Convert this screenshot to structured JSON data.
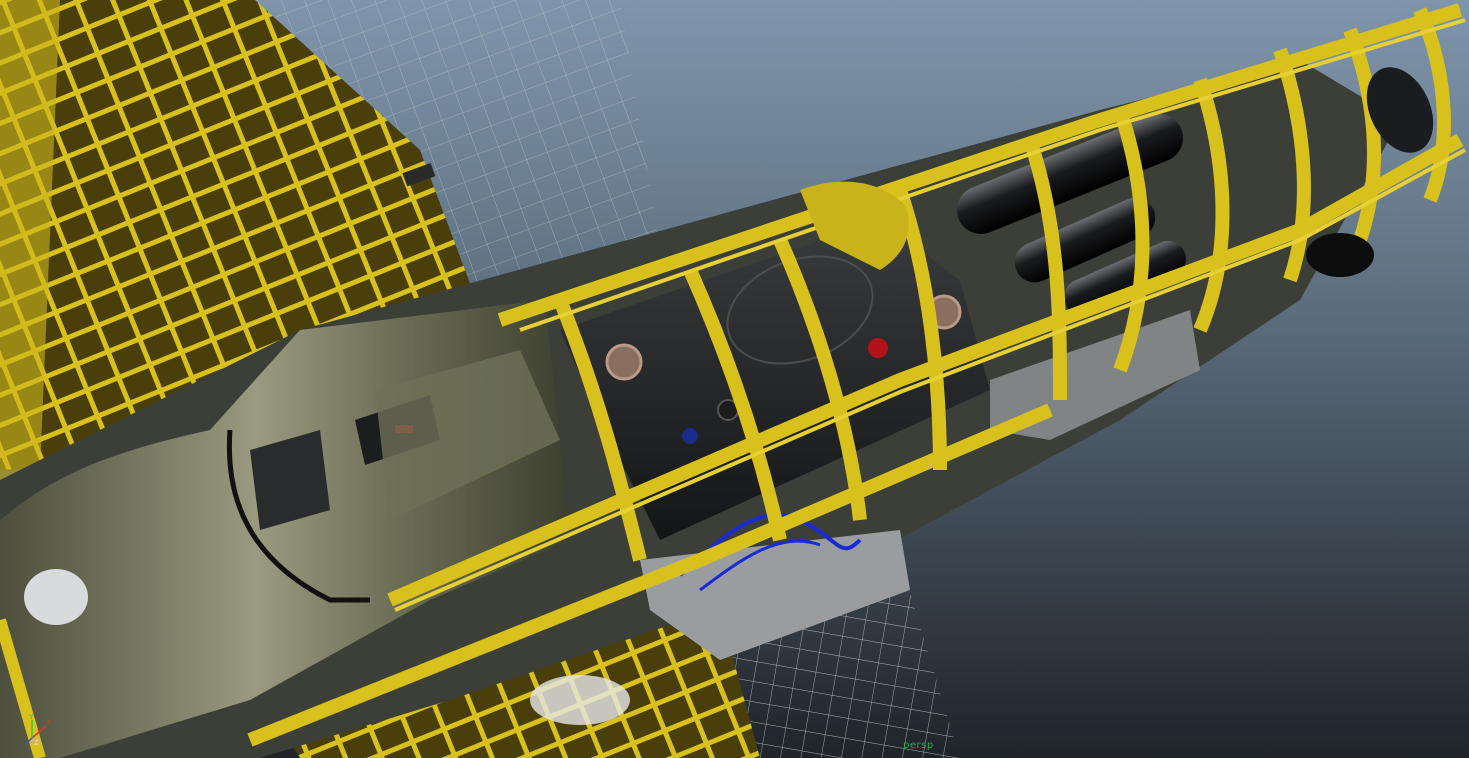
{
  "viewport": {
    "camera_label": "persp",
    "background_top": "#7f95ab",
    "background_bottom": "#1f2429"
  },
  "colors": {
    "frame_yellow": "#d8c11c",
    "frame_dark": "#5b4e0c",
    "olive_skin": "#6f7156",
    "tank_black": "#1d1e20",
    "fuel_line_blue": "#1a2bd6",
    "wire_grey": "#b9bcbf"
  },
  "axis_gizmo": {
    "x_label": "X",
    "y_label": "Y",
    "z_label": "Z",
    "x_color": "#e0302a",
    "y_color": "#35c43a",
    "z_color": "#3050e0"
  },
  "icons": [
    "axis-gizmo-icon"
  ]
}
